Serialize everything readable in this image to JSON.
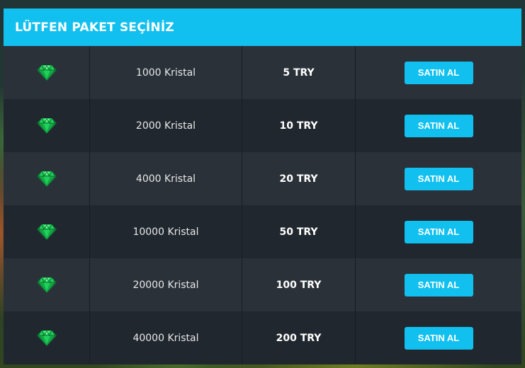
{
  "panel": {
    "title": "LÜTFEN PAKET SEÇİNİZ"
  },
  "packages": [
    {
      "icon": "crystal-icon",
      "name": "1000 Kristal",
      "price": "5 TRY",
      "button_label": "SATIN AL"
    },
    {
      "icon": "crystal-icon",
      "name": "2000 Kristal",
      "price": "10 TRY",
      "button_label": "SATIN AL"
    },
    {
      "icon": "crystal-icon",
      "name": "4000 Kristal",
      "price": "20 TRY",
      "button_label": "SATIN AL"
    },
    {
      "icon": "crystal-icon",
      "name": "10000 Kristal",
      "price": "50 TRY",
      "button_label": "SATIN AL"
    },
    {
      "icon": "crystal-icon",
      "name": "20000 Kristal",
      "price": "100 TRY",
      "button_label": "SATIN AL"
    },
    {
      "icon": "crystal-icon",
      "name": "40000 Kristal",
      "price": "200 TRY",
      "button_label": "SATIN AL"
    }
  ],
  "colors": {
    "accent": "#12c0ef",
    "row_light": "#2a3138",
    "row_dark": "#20272e",
    "gem": "#1fd05a"
  }
}
